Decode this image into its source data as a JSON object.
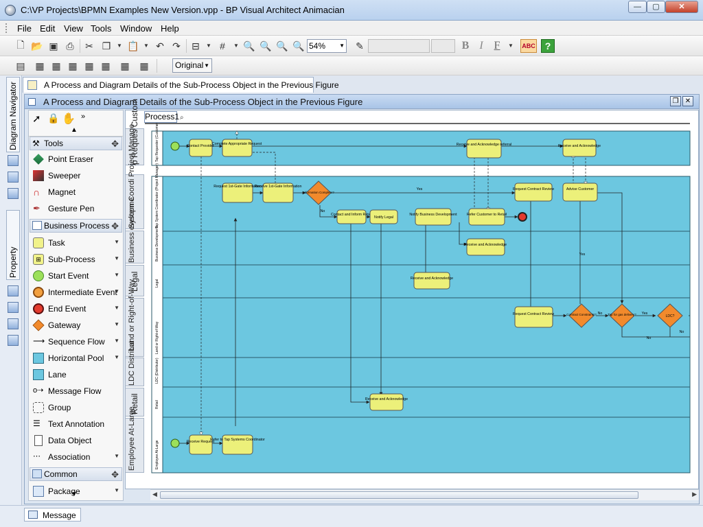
{
  "window": {
    "title": "C:\\VP Projects\\BPMN Examples New Version.vpp - BP Visual Architect Animacian",
    "minimize_label": "—",
    "maximize_label": "▢",
    "close_label": "✕"
  },
  "menu": [
    "File",
    "Edit",
    "View",
    "Tools",
    "Window",
    "Help"
  ],
  "toolbar": {
    "zoom_value": "54%",
    "font_size_value": "",
    "font_name_value": "",
    "bold_label": "B",
    "italic_label": "I",
    "font_color_label": "F",
    "spell_label": "ABC",
    "help_label": "?",
    "view_mode_value": "Original"
  },
  "side_tabs": {
    "navigator": "Diagram Navigator",
    "property": "Property"
  },
  "document_tab": {
    "title": "A Process and Diagram Details of the Sub-Process Object in the Previous Figure"
  },
  "diagram_frame": {
    "title": "A Process and Diagram Details of the Sub-Process Object in the Previous Figure"
  },
  "palette": {
    "sections": {
      "tools": "Tools",
      "business_process": "Business Process",
      "common": "Common",
      "package": "Package"
    },
    "tools_items": [
      "Point Eraser",
      "Sweeper",
      "Magnet",
      "Gesture Pen"
    ],
    "bp_items": [
      "Task",
      "Sub-Process",
      "Start Event",
      "Intermediate Event",
      "End Event",
      "Gateway",
      "Sequence Flow",
      "Horizontal Pool",
      "Lane",
      "Message Flow",
      "Group",
      "Text Annotation",
      "Data Object",
      "Association"
    ]
  },
  "process_tab": "Process1",
  "pool_labels": [
    "p Reques Custom",
    "System Coordi Project Manage",
    "Business evelopme",
    "Legal",
    "Land or Right-of-Way",
    "LDC Distribut",
    "Retail",
    "Employee At-Large"
  ],
  "lane_titles": {
    "tap_requester": "Tap Requester (Customer)",
    "tsc": "Tap System Coordinator (Project Manager)",
    "bd": "Business Development",
    "legal": "Legal",
    "land": "Land or Right-of-Way",
    "ldc": "LDC (Distributor)",
    "retail": "Retail",
    "employee": "Employee At-Large"
  },
  "tasks": {
    "contact_provider": "Contact Provider",
    "complete_request": "Complete Appropriate Request",
    "recv_ack_referral": "Receive and Acknowledge referral",
    "recv_ack_1": "Receive and Acknowledge",
    "req_1st_gate": "Request 1st-Gate Information",
    "recv_1st_gate": "Receive 1st-Gate Information",
    "gateway_1": "Information Complete?",
    "yes_1": "Yes",
    "no_1": "No",
    "req_contract_review_1": "Request Contract Review",
    "advise_customer": "Advise Customer",
    "contact_inform_retail": "Contact and Inform Retail",
    "notify_legal": "Notify Legal",
    "notify_bd": "Notify Business Development",
    "refer_customer_retail": "Refer Customer to Retail",
    "recv_ack_bd": "Receive and Acknowledge",
    "recv_ack_legal": "Receive and Acknowledge",
    "yes_adv": "Yes",
    "req_contract_review_2": "Request Contract Review",
    "gw_contract": "Contract Constraints?",
    "no_c": "No",
    "gw_tap": "Tap for gas delivery?",
    "yes_t": "Yes",
    "gw_ldc": "LDC?",
    "no_t": "No",
    "no_l": "No",
    "recv_ack_retail": "Receive and Acknowledge",
    "receive_request": "Receive Request",
    "refer_tsc": "Refer to Tap Systems Coordinator"
  },
  "bottom": {
    "message_tab": "Message"
  },
  "colors": {
    "lane_fill": "#6cc7e0",
    "task_fill": "#ecf07a",
    "gateway_fill": "#f28a2c",
    "start_fill": "#9ce05a",
    "end_fill": "#e33b2e"
  }
}
